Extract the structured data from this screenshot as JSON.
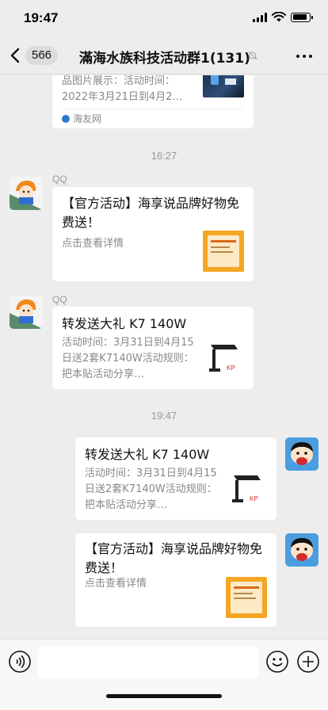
{
  "status": {
    "time": "19:47"
  },
  "nav": {
    "unread_count": "566",
    "title": "滿海水族科技活动群1(131)"
  },
  "messages": [
    {
      "kind": "link_card_partial",
      "desc_lines": [
        "品图片展示：活动时间：",
        "2022年3月21日到4月2…"
      ],
      "source": "海友网"
    },
    {
      "kind": "timestamp",
      "text": "16:27"
    },
    {
      "kind": "link_card",
      "side": "left",
      "sender": "QQ",
      "title": "【官方活动】海享说品牌好物免费送！",
      "desc": "点击查看详情"
    },
    {
      "kind": "link_card",
      "side": "left",
      "sender": "QQ",
      "title": "转发送大礼 K7 140W",
      "desc": "活动时间：3月31日到4月15日送2套K7140W活动规则：把本贴活动分享…"
    },
    {
      "kind": "timestamp",
      "text": "19:47"
    },
    {
      "kind": "link_card",
      "side": "right",
      "title": "转发送大礼 K7 140W",
      "desc": "活动时间：3月31日到4月15日送2套K7140W活动规则：把本贴活动分享…"
    },
    {
      "kind": "link_card",
      "side": "right",
      "title": "【官方活动】海享说品牌好物免费送！",
      "desc": "点击查看详情"
    }
  ],
  "colors": {
    "background": "#ededed",
    "card": "#ffffff",
    "meta_text": "#999999",
    "accent_orange": "#f5a623"
  }
}
